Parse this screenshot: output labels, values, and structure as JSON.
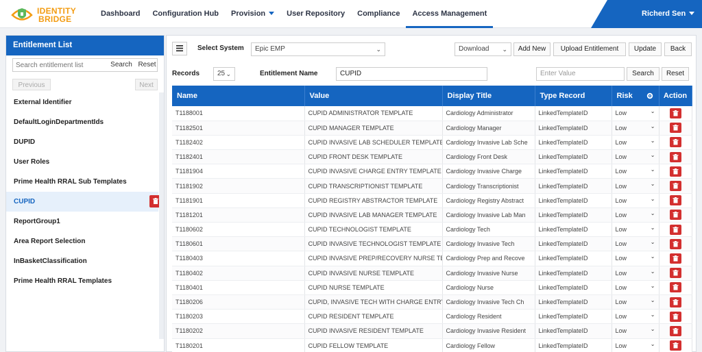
{
  "brand": {
    "line1": "IDENTITY",
    "line2": "BRIDGE",
    "colors": {
      "orange": "#f39c12",
      "green": "#5cb85c"
    }
  },
  "nav": {
    "items": [
      {
        "label": "Dashboard"
      },
      {
        "label": "Configuration Hub"
      },
      {
        "label": "Provision"
      },
      {
        "label": "User Repository"
      },
      {
        "label": "Compliance"
      },
      {
        "label": "Access Management"
      }
    ],
    "active": "Access Management",
    "user": "Richerd Sen"
  },
  "sidebar": {
    "title": "Entitlement List",
    "search": {
      "placeholder": "Search entitlement list",
      "search_label": "Search",
      "reset_label": "Reset"
    },
    "previous_label": "Previous",
    "next_label": "Next",
    "items": [
      {
        "label": "External Identifier"
      },
      {
        "label": "DefaultLoginDepartmentIds"
      },
      {
        "label": "DUPID"
      },
      {
        "label": "User Roles"
      },
      {
        "label": "Prime Health RRAL Sub Templates"
      },
      {
        "label": "CUPID"
      },
      {
        "label": "ReportGroup1"
      },
      {
        "label": "Area Report Selection"
      },
      {
        "label": "InBasketClassification"
      },
      {
        "label": "Prime Health RRAL Templates"
      }
    ],
    "selected": "CUPID"
  },
  "toolbar": {
    "menu_icon": "hamburger-icon",
    "select_system_label": "Select System",
    "system_value": "Epic EMP",
    "download_label": "Download",
    "add_new_label": "Add New",
    "upload_label": "Upload Entitlement",
    "update_label": "Update",
    "back_label": "Back"
  },
  "filters": {
    "records_label": "Records",
    "records_value": "25",
    "entitlement_name_label": "Entitlement Name",
    "entitlement_name_value": "CUPID",
    "value_placeholder": "Enter Value",
    "search_label": "Search",
    "reset_label": "Reset"
  },
  "table": {
    "headers": {
      "name": "Name",
      "value": "Value",
      "display_title": "Display Title",
      "type_record": "Type Record",
      "risk": "Risk",
      "action": "Action"
    },
    "rows": [
      {
        "name": "T1188001",
        "value": "CUPID ADMINISTRATOR TEMPLATE",
        "display": "Cardiology Administrator",
        "type": "LinkedTemplateID",
        "risk": "Low"
      },
      {
        "name": "T1182501",
        "value": "CUPID MANAGER TEMPLATE",
        "display": "Cardiology Manager",
        "type": "LinkedTemplateID",
        "risk": "Low"
      },
      {
        "name": "T1182402",
        "value": "CUPID INVASIVE LAB SCHEDULER TEMPLATE",
        "display": "Cardiology Invasive Lab Sche",
        "type": "LinkedTemplateID",
        "risk": "Low"
      },
      {
        "name": "T1182401",
        "value": "CUPID FRONT DESK TEMPLATE",
        "display": "Cardiology Front Desk",
        "type": "LinkedTemplateID",
        "risk": "Low"
      },
      {
        "name": "T1181904",
        "value": "CUPID INVASIVE CHARGE ENTRY TEMPLATE",
        "display": "Cardiology Invasive Charge",
        "type": "LinkedTemplateID",
        "risk": "Low"
      },
      {
        "name": "T1181902",
        "value": "CUPID TRANSCRIPTIONIST TEMPLATE",
        "display": "Cardiology Transcriptionist",
        "type": "LinkedTemplateID",
        "risk": "Low"
      },
      {
        "name": "T1181901",
        "value": "CUPID REGISTRY ABSTRACTOR TEMPLATE",
        "display": "Cardiology Registry Abstract",
        "type": "LinkedTemplateID",
        "risk": "Low"
      },
      {
        "name": "T1181201",
        "value": "CUPID INVASIVE LAB MANAGER TEMPLATE",
        "display": "Cardiology Invasive Lab Man",
        "type": "LinkedTemplateID",
        "risk": "Low"
      },
      {
        "name": "T1180602",
        "value": "CUPID TECHNOLOGIST TEMPLATE",
        "display": "Cardiology Tech",
        "type": "LinkedTemplateID",
        "risk": "Low"
      },
      {
        "name": "T1180601",
        "value": "CUPID INVASIVE TECHNOLOGIST TEMPLATE",
        "display": "Cardiology Invasive Tech",
        "type": "LinkedTemplateID",
        "risk": "Low"
      },
      {
        "name": "T1180403",
        "value": "CUPID INVASIVE PREP/RECOVERY NURSE TEMF",
        "display": "Cardiology Prep and Recove",
        "type": "LinkedTemplateID",
        "risk": "Low"
      },
      {
        "name": "T1180402",
        "value": "CUPID INVASIVE NURSE TEMPLATE",
        "display": "Cardiology Invasive Nurse",
        "type": "LinkedTemplateID",
        "risk": "Low"
      },
      {
        "name": "T1180401",
        "value": "CUPID NURSE TEMPLATE",
        "display": "Cardiology Nurse",
        "type": "LinkedTemplateID",
        "risk": "Low"
      },
      {
        "name": "T1180206",
        "value": "CUPID, INVASIVE TECH WITH CHARGE ENTRY",
        "display": "Cardiology Invasive Tech Ch",
        "type": "LinkedTemplateID",
        "risk": "Low"
      },
      {
        "name": "T1180203",
        "value": "CUPID RESIDENT TEMPLATE",
        "display": "Cardiology Resident",
        "type": "LinkedTemplateID",
        "risk": "Low"
      },
      {
        "name": "T1180202",
        "value": "CUPID INVASIVE RESIDENT TEMPLATE",
        "display": "Cardiology Invasive Resident",
        "type": "LinkedTemplateID",
        "risk": "Low"
      },
      {
        "name": "T1180201",
        "value": "CUPID FELLOW TEMPLATE",
        "display": "Cardiology Fellow",
        "type": "LinkedTemplateID",
        "risk": "Low"
      }
    ]
  },
  "colors": {
    "primary": "#1565c0",
    "delete": "#d32f2f",
    "selected_bg": "#e6f0fb"
  }
}
